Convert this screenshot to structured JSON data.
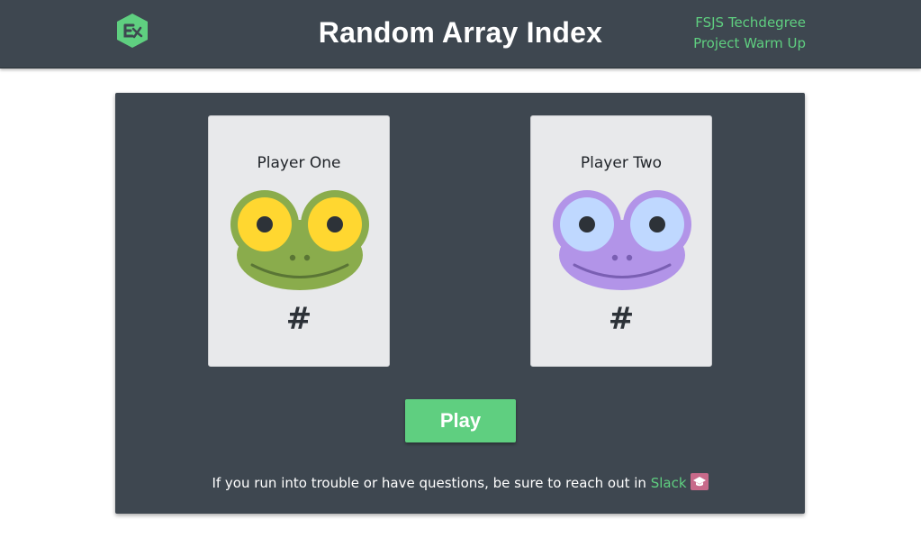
{
  "header": {
    "title": "Random Array Index",
    "subtitle_line1": "FSJS Techdegree",
    "subtitle_line2": "Project Warm Up",
    "logo_icon": "treehouse-logo-icon",
    "accent_color": "#5fcf80",
    "background_color": "#3e4750"
  },
  "players": [
    {
      "name": "Player One",
      "value": "#",
      "avatar_icon": "green-frog-icon"
    },
    {
      "name": "Player Two",
      "value": "#",
      "avatar_icon": "purple-frog-icon"
    }
  ],
  "controls": {
    "play_label": "Play"
  },
  "footer": {
    "text": "If you run into trouble or have questions, be sure to reach out in ",
    "link_label": "Slack",
    "link_icon": "graduation-cap-icon"
  }
}
